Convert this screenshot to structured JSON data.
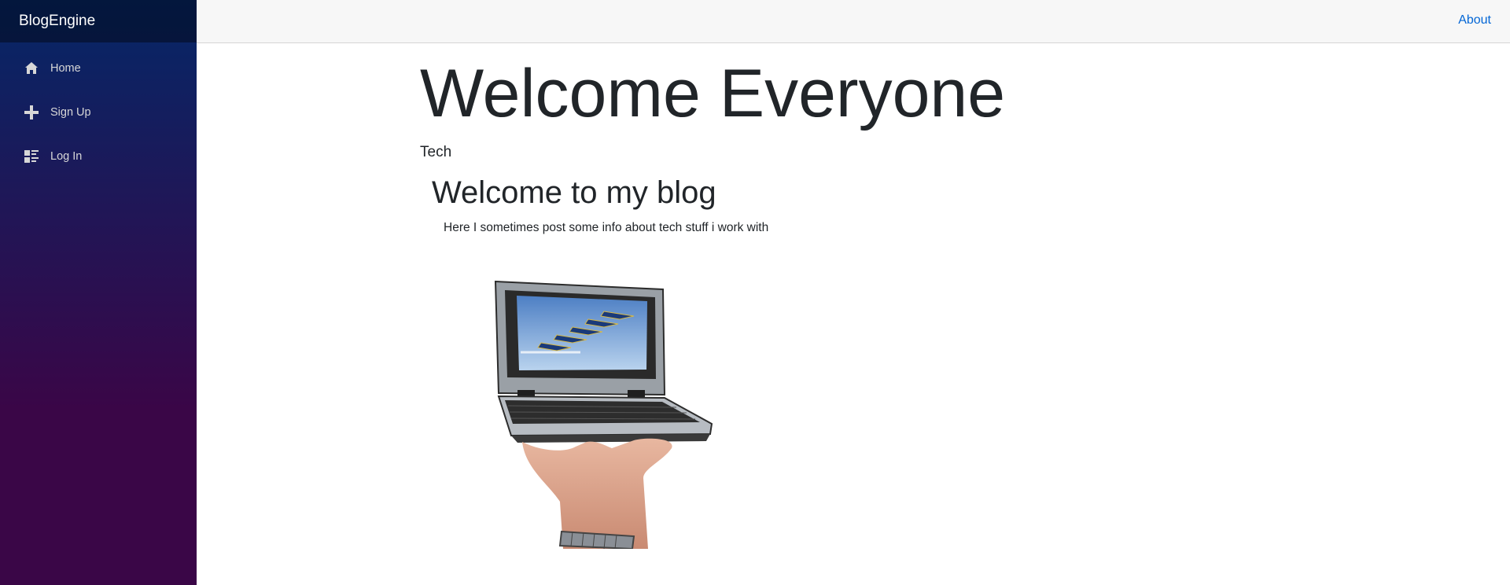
{
  "sidebar": {
    "brand": "BlogEngine",
    "items": [
      {
        "label": "Home",
        "icon": "home-icon"
      },
      {
        "label": "Sign Up",
        "icon": "plus-icon"
      },
      {
        "label": "Log In",
        "icon": "list-rich-icon"
      }
    ]
  },
  "topbar": {
    "about_label": "About"
  },
  "main": {
    "title": "Welcome Everyone",
    "category": "Tech",
    "post": {
      "title": "Welcome to my blog",
      "body": "Here I sometimes post some info about tech stuff i work with",
      "image": "laptop-on-hand-image"
    }
  },
  "colors": {
    "sidebar_top": "#052767",
    "sidebar_bottom": "#3a0647",
    "link": "#0366d6",
    "topbar_bg": "#f7f7f7"
  }
}
